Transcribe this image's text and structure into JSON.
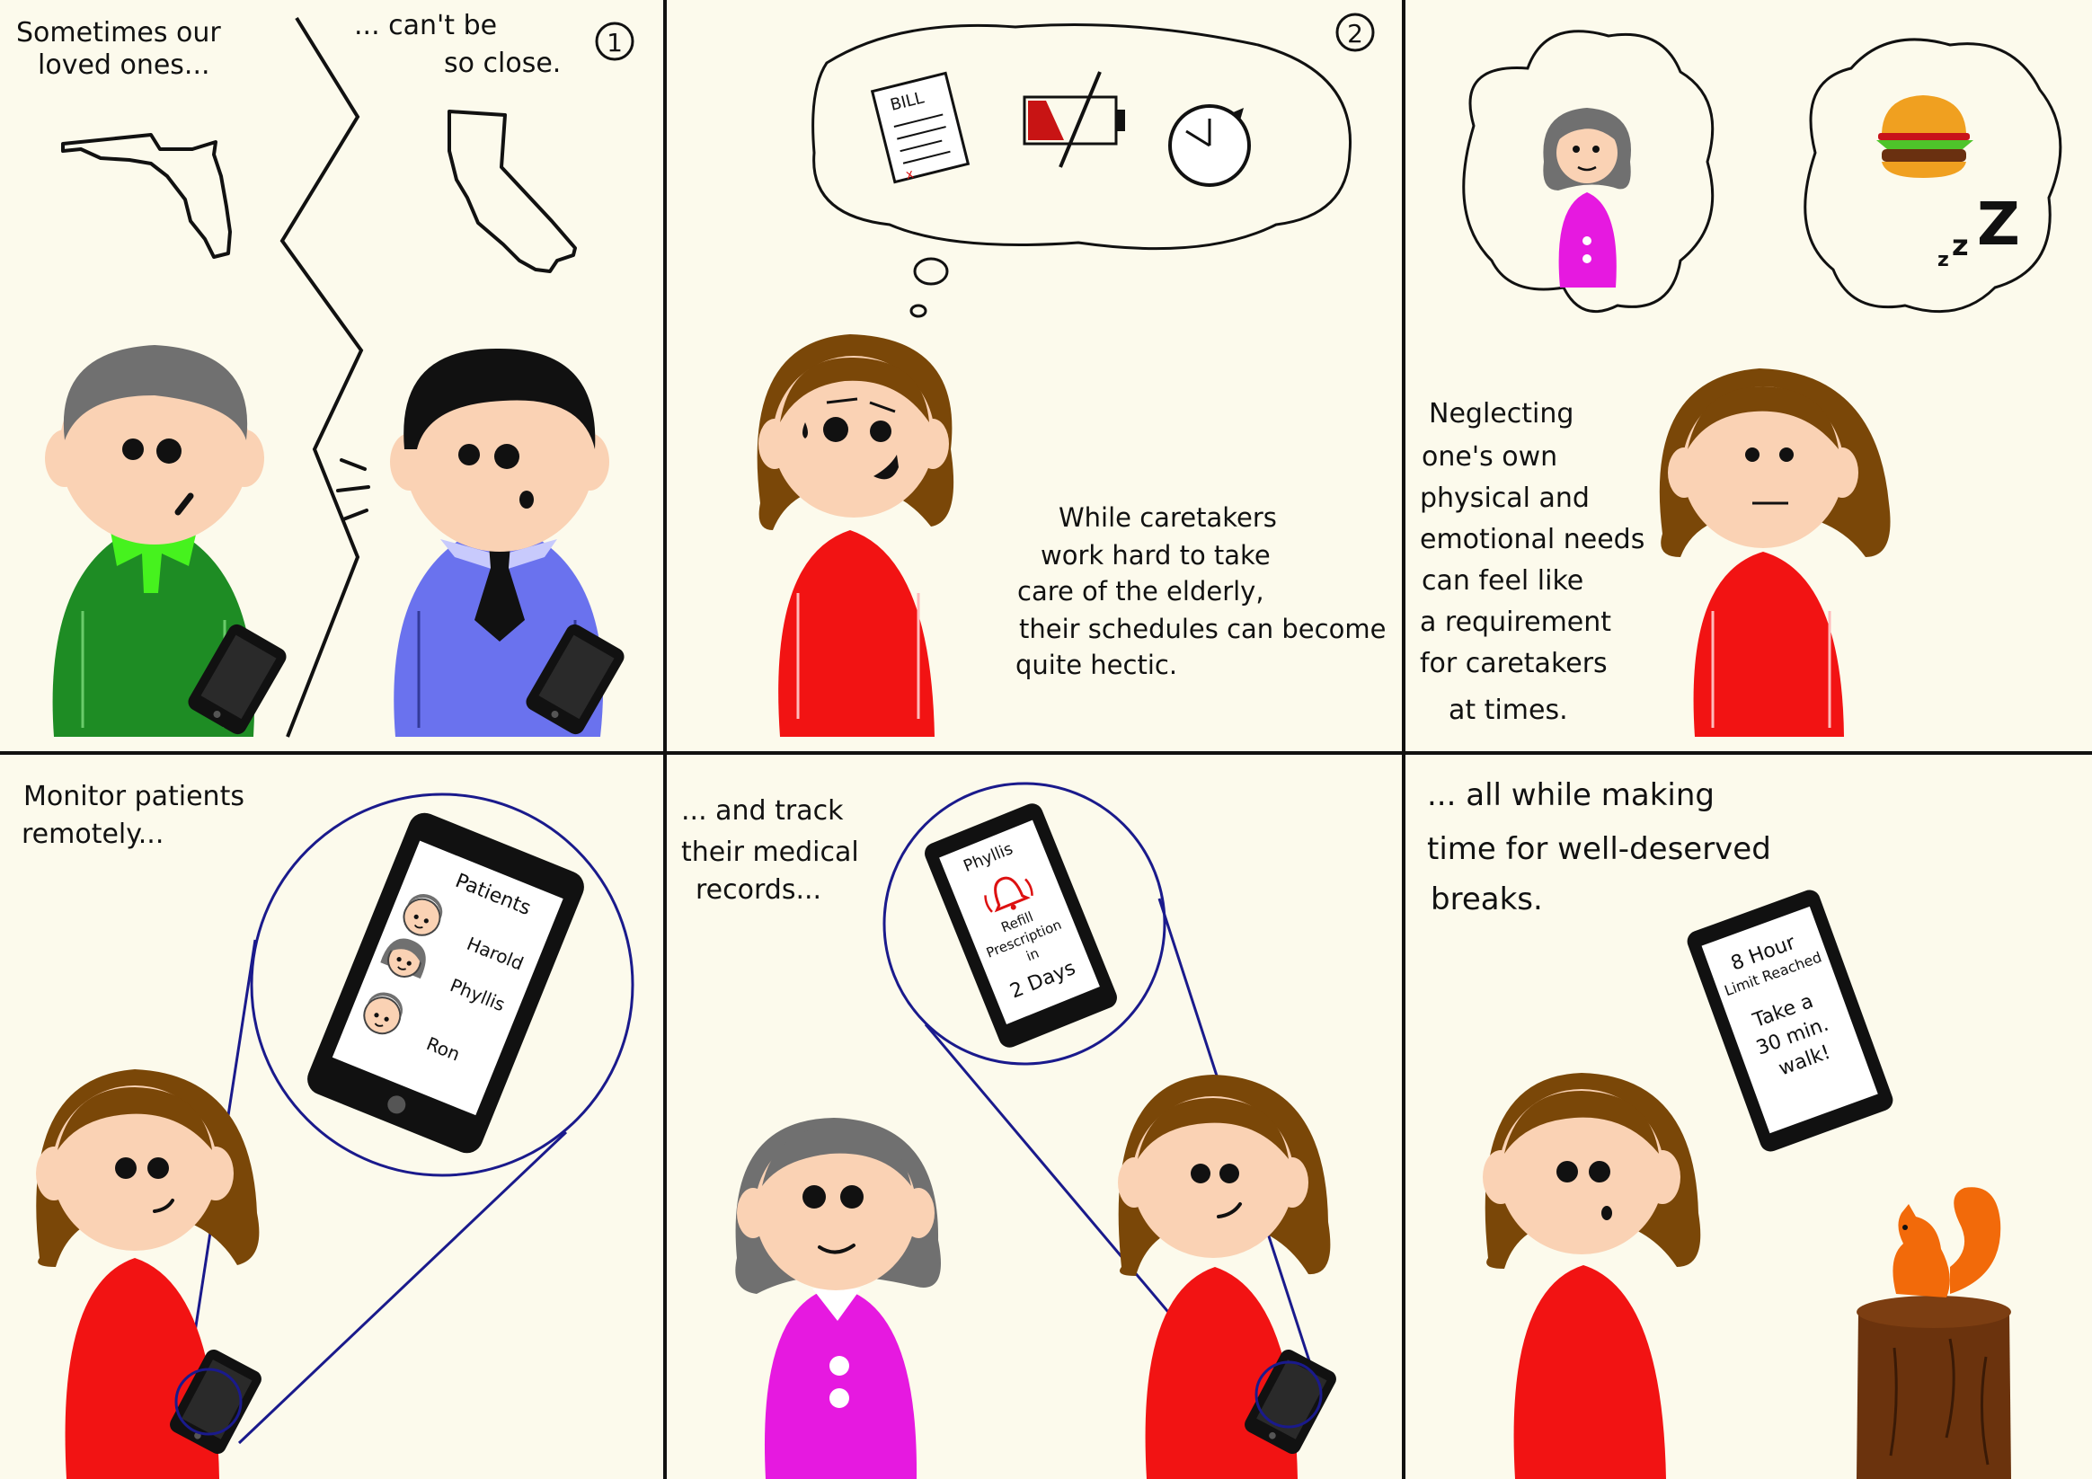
{
  "panels": {
    "p1": {
      "number": "1",
      "caption_left": [
        "Sometimes our",
        "loved ones..."
      ],
      "caption_right": [
        "... can't be",
        "so close."
      ]
    },
    "p2": {
      "number": "2",
      "bill_label": "BILL",
      "caption": [
        "While caretakers",
        "work hard to take",
        "care of the elderly,",
        "their schedules can become",
        "quite hectic."
      ]
    },
    "p3": {
      "sleep_text": [
        "z",
        "z",
        "Z"
      ],
      "caption": [
        "Neglecting",
        "one's own",
        "physical and",
        "emotional needs",
        "can feel like",
        "a requirement",
        "for caretakers",
        "at times."
      ]
    },
    "p4": {
      "caption": [
        "Monitor patients",
        "remotely..."
      ],
      "screen_title": "Patients",
      "patients": [
        "Harold",
        "Phyllis",
        "Ron"
      ]
    },
    "p5": {
      "caption": [
        "... and track",
        "their medical",
        "records..."
      ],
      "screen_name": "Phyllis",
      "alert": [
        "Refill",
        "Prescription",
        "in",
        "2 Days"
      ]
    },
    "p6": {
      "caption": [
        "... all while making",
        "time for well-deserved",
        "breaks."
      ],
      "limit": [
        "8 Hour",
        "Limit Reached"
      ],
      "advice": [
        "Take a",
        "30 min.",
        "walk!"
      ]
    }
  },
  "colors": {
    "background": "#fcfaec",
    "skin": "#fad2b4",
    "brown_hair": "#7a4708",
    "gray_hair": "#707070",
    "black_hair": "#111111",
    "red_shirt": "#f21313",
    "green_shirt": "#1e8c24",
    "green_collar": "#46f21e",
    "blue_shirt": "#6a72ee",
    "pink_shirt": "#e619e0",
    "navy_line": "#1a1a8c",
    "stump": "#6b330d",
    "squirrel": "#f26a0a"
  }
}
